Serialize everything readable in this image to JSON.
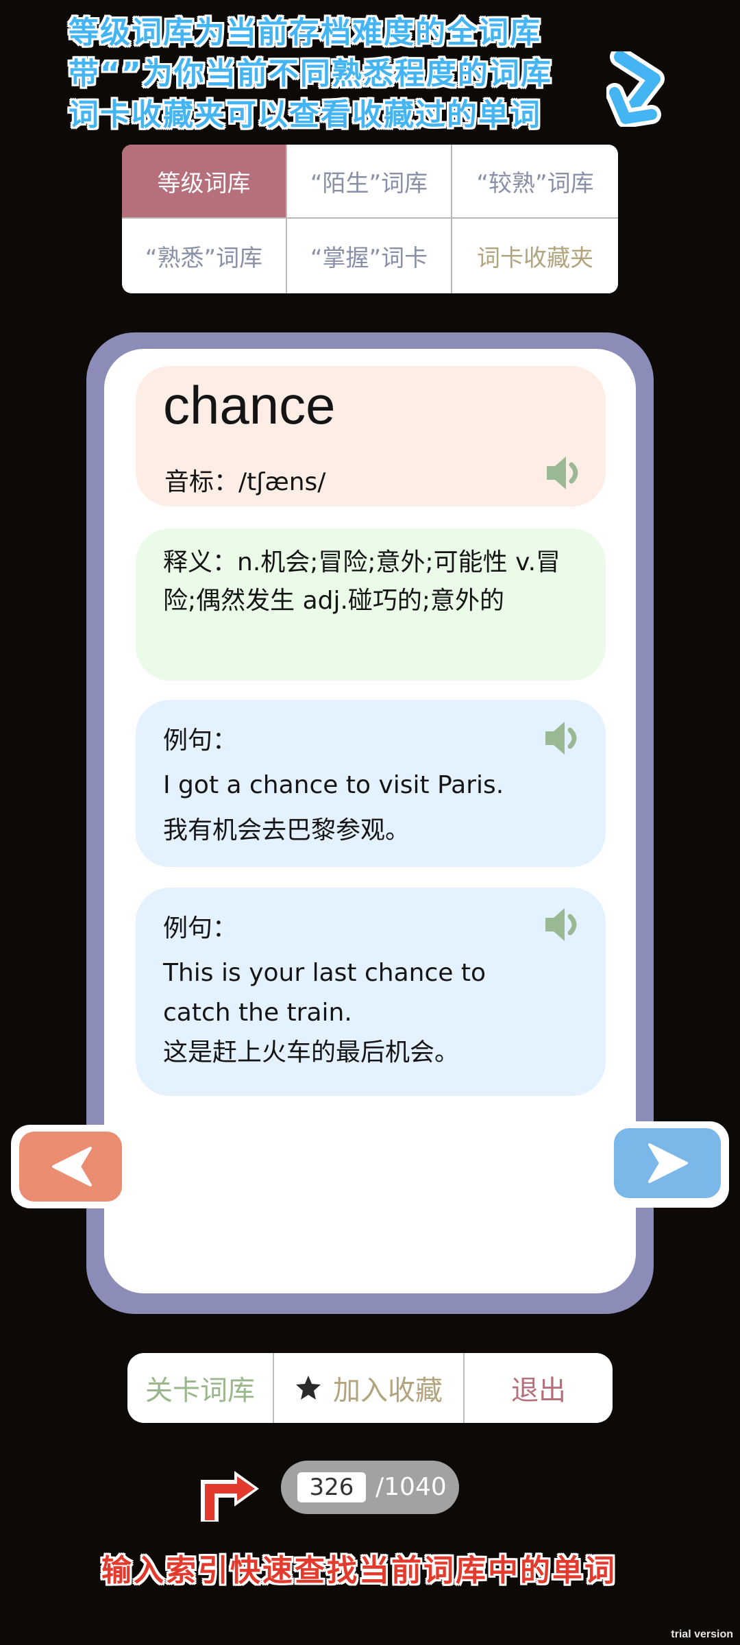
{
  "hint_top": {
    "line1": "等级词库为当前存档难度的全词库",
    "line2": "带“”为你当前不同熟悉程度的词库",
    "line3": "词卡收藏夹可以查看收藏过的单词"
  },
  "tabs": [
    {
      "label": "等级词库",
      "active": true
    },
    {
      "label": "“陌生”词库"
    },
    {
      "label": "“较熟”词库"
    },
    {
      "label": "“熟悉”词库"
    },
    {
      "label": "“掌握”词卡"
    },
    {
      "label": "词卡收藏夹"
    }
  ],
  "card": {
    "word": "chance",
    "phonetic": "音标：/tʃæns/",
    "meaning": "释义：n.机会;冒险;意外;可能性 v.冒险;偶然发生 adj.碰巧的;意外的",
    "examples": [
      {
        "label": "例句：",
        "en": "I got a chance to visit Paris.",
        "zh": "我有机会去巴黎参观。"
      },
      {
        "label": "例句：",
        "en": "This is your last chance to catch the train.",
        "zh": "这是赶上火车的最后机会。"
      }
    ]
  },
  "bottom_bar": {
    "level_lib": "关卡词库",
    "add_fav": "加入收藏",
    "exit": "退出"
  },
  "index": {
    "current": "326",
    "total": "/1040"
  },
  "hint_bottom": "输入索引快速查找当前词库中的单词",
  "watermark": "trial version",
  "colors": {
    "background": "#0c0906",
    "active_tab": "#b5707c",
    "card_frame": "#8c8cb8",
    "word_block": "#fdeee5",
    "meaning_block": "#eafbe8",
    "example_block": "#e4f1fe",
    "prev_button": "#ea8c72",
    "next_button": "#7bb8ea",
    "speaker": "#9bb894",
    "hint_blue": "#45b4f2",
    "hint_red": "#e23a2c"
  },
  "icons": {
    "speaker": "speaker-icon",
    "prev": "chevron-left-icon",
    "next": "chevron-right-icon",
    "star": "star-icon",
    "arrow_top": "curved-arrow-down-left-icon",
    "arrow_bottom": "bent-arrow-right-icon"
  }
}
